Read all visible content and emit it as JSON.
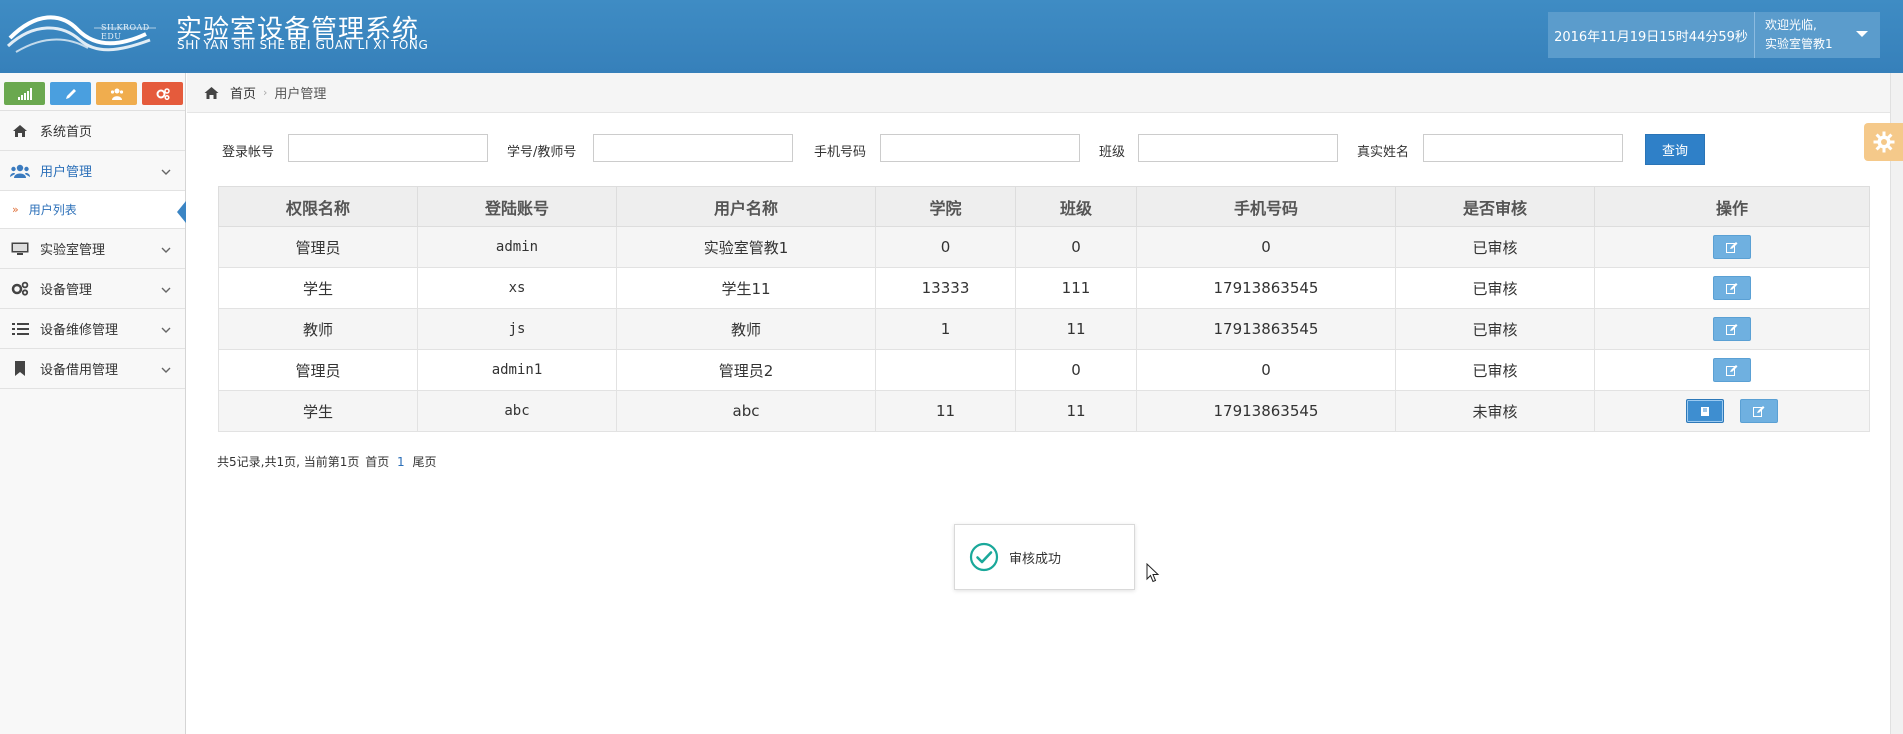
{
  "header": {
    "logo_text": "SILKROAD EDU",
    "title": "实验室设备管理系统",
    "subtitle": "SHI YAN SHI SHE BEI GUAN LI XI TONG",
    "datetime": "2016年11月19日15时44分59秒",
    "welcome": "欢迎光临,",
    "username": "实验室管教1"
  },
  "sidebar": {
    "shortcuts": [
      {
        "icon": "signal-icon",
        "color": "#6aa84f"
      },
      {
        "icon": "pencil-icon",
        "color": "#4a9fdf"
      },
      {
        "icon": "users-icon",
        "color": "#f0ad4e"
      },
      {
        "icon": "cogs-icon",
        "color": "#e55b3c"
      }
    ],
    "menu": [
      {
        "label": "系统首页",
        "icon": "home-icon"
      },
      {
        "label": "用户管理",
        "icon": "users-icon"
      },
      {
        "label": "实验室管理",
        "icon": "desktop-icon"
      },
      {
        "label": "设备管理",
        "icon": "cogs-icon"
      },
      {
        "label": "设备维修管理",
        "icon": "list-icon"
      },
      {
        "label": "设备借用管理",
        "icon": "bookmark-icon"
      }
    ],
    "submenu": {
      "label": "用户列表",
      "marker": "»"
    }
  },
  "breadcrumb": {
    "home": "首页",
    "current": "用户管理"
  },
  "search": {
    "fields": [
      {
        "label": "登录帐号",
        "value": ""
      },
      {
        "label": "学号/教师号",
        "value": ""
      },
      {
        "label": "手机号码",
        "value": ""
      },
      {
        "label": "班级",
        "value": ""
      },
      {
        "label": "真实姓名",
        "value": ""
      }
    ],
    "button": "查询"
  },
  "table": {
    "headers": [
      "权限名称",
      "登陆账号",
      "用户名称",
      "学院",
      "班级",
      "手机号码",
      "是否审核",
      "操作"
    ],
    "rows": [
      {
        "role": "管理员",
        "account": "admin",
        "name": "实验室管教1",
        "college": "0",
        "class": "0",
        "phone": "0",
        "status": "已审核",
        "pending": false
      },
      {
        "role": "学生",
        "account": "xs",
        "name": "学生11",
        "college": "13333",
        "class": "111",
        "phone": "17913863545",
        "status": "已审核",
        "pending": false
      },
      {
        "role": "教师",
        "account": "js",
        "name": "教师",
        "college": "1",
        "class": "11",
        "phone": "17913863545",
        "status": "已审核",
        "pending": false
      },
      {
        "role": "管理员",
        "account": "admin1",
        "name": "管理员2",
        "college": "",
        "class": "0",
        "phone": "0",
        "status": "已审核",
        "pending": false
      },
      {
        "role": "学生",
        "account": "abc",
        "name": "abc",
        "college": "11",
        "class": "11",
        "phone": "17913863545",
        "status": "未审核",
        "pending": true
      }
    ]
  },
  "pagination": {
    "summary": "共5记录,共1页, 当前第1页",
    "first": "首页",
    "current": "1",
    "last": "尾页"
  },
  "toast": {
    "message": "审核成功"
  },
  "colors": {
    "header": "#3a86c0",
    "status_ok": "#1a2fb5",
    "status_pending": "#e23a1f",
    "button": "#2f80c8"
  }
}
